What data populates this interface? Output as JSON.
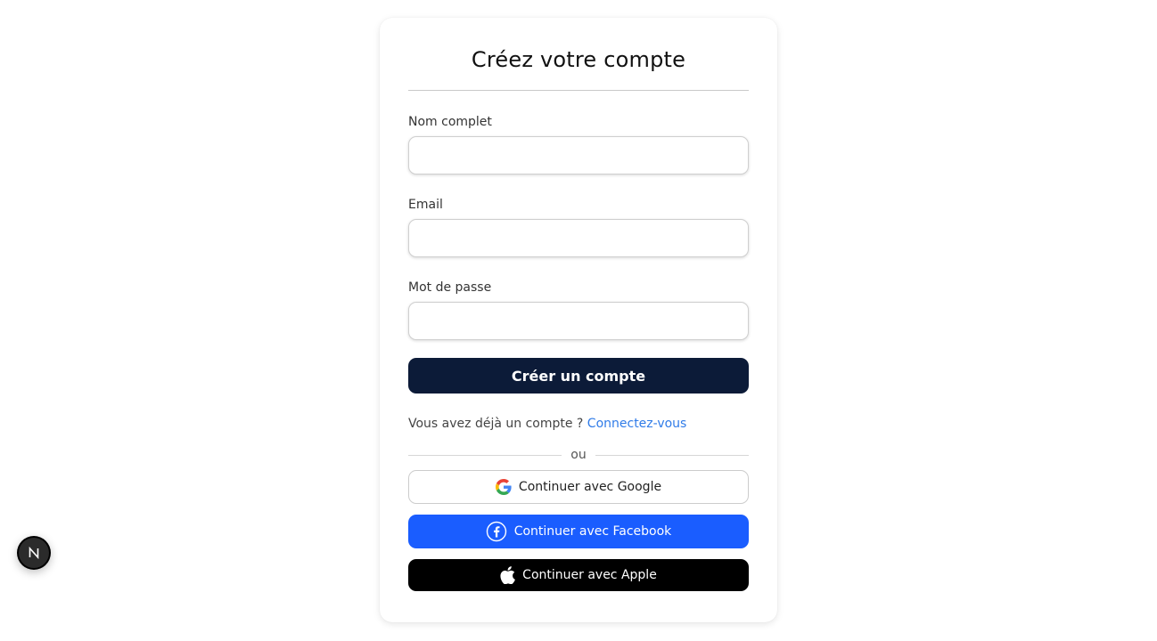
{
  "form": {
    "title": "Créez votre compte",
    "fields": [
      {
        "label": "Nom complet",
        "value": "",
        "placeholder": ""
      },
      {
        "label": "Email",
        "value": "",
        "placeholder": ""
      },
      {
        "label": "Mot de passe",
        "value": "",
        "placeholder": ""
      }
    ],
    "submit_label": "Créer un compte",
    "signin_prompt": "Vous avez déjà un compte ?",
    "signin_link": "Connectez-vous",
    "divider_text": "ou"
  },
  "social": {
    "google_label": "Continuer avec Google",
    "facebook_label": "Continuer avec Facebook",
    "apple_label": "Continuer avec Apple"
  },
  "icons": {
    "google": "google-logo-icon",
    "facebook": "facebook-logo-icon",
    "apple": "apple-logo-icon",
    "nextjs": "nextjs-logo-icon"
  },
  "colors": {
    "primary_button": "#0c1b38",
    "link": "#2f7be8",
    "facebook": "#1a5dff",
    "apple": "#000000"
  }
}
